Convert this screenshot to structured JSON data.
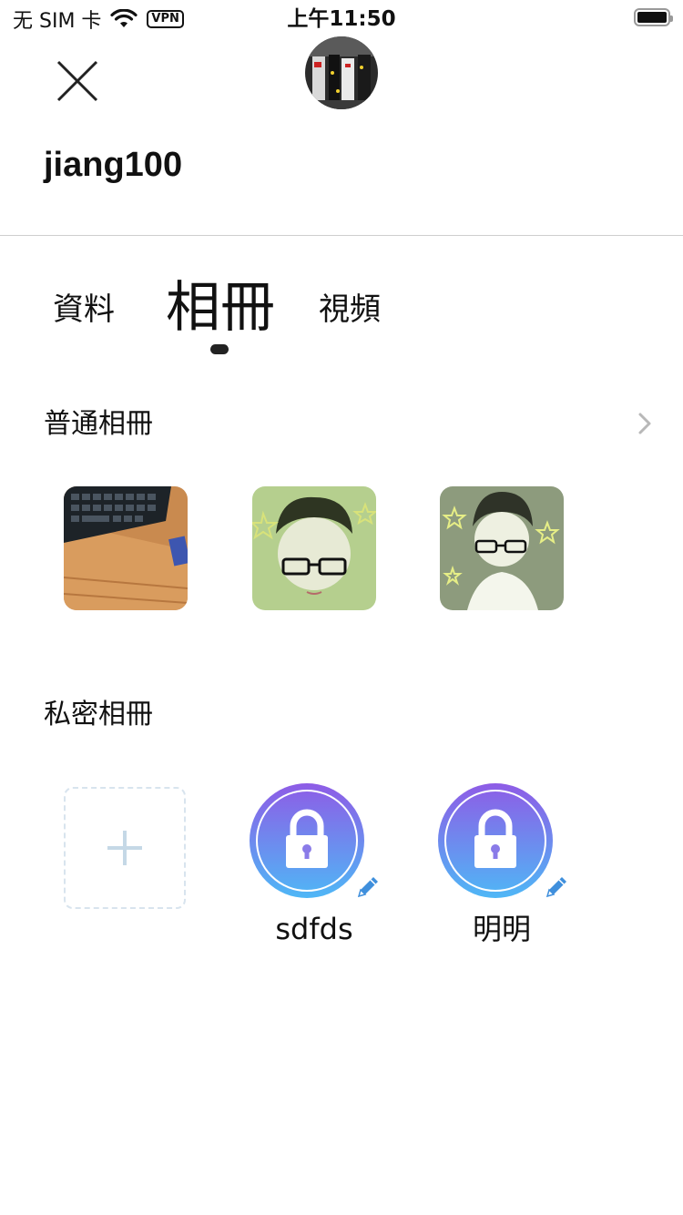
{
  "status_bar": {
    "carrier": "无 SIM 卡",
    "vpn": "VPN",
    "time": "上午11:50"
  },
  "profile": {
    "username": "jiang100"
  },
  "tabs": [
    {
      "label": "資料",
      "active": false
    },
    {
      "label": "相冊",
      "active": true
    },
    {
      "label": "視頻",
      "active": false
    }
  ],
  "public_albums": {
    "title": "普通相冊",
    "photos": [
      {
        "subject": "keyboard on desk"
      },
      {
        "subject": "cartoon boy with glasses"
      },
      {
        "subject": "cartoon boy with glasses and stars"
      }
    ]
  },
  "private_albums": {
    "title": "私密相冊",
    "albums": [
      {
        "name": "sdfds"
      },
      {
        "name": "明明"
      }
    ]
  },
  "colors": {
    "lock_gradient_top": "#8e5ce6",
    "lock_gradient_bottom": "#4fb7f6",
    "edit_icon": "#3f8fdc",
    "add_border": "#d8e4ee",
    "add_plus": "#c5d8e6"
  },
  "icons": {
    "close": "close-icon",
    "chevron": "chevron-right-icon",
    "lock": "lock-icon",
    "edit": "pencil-icon",
    "add": "plus-icon"
  }
}
